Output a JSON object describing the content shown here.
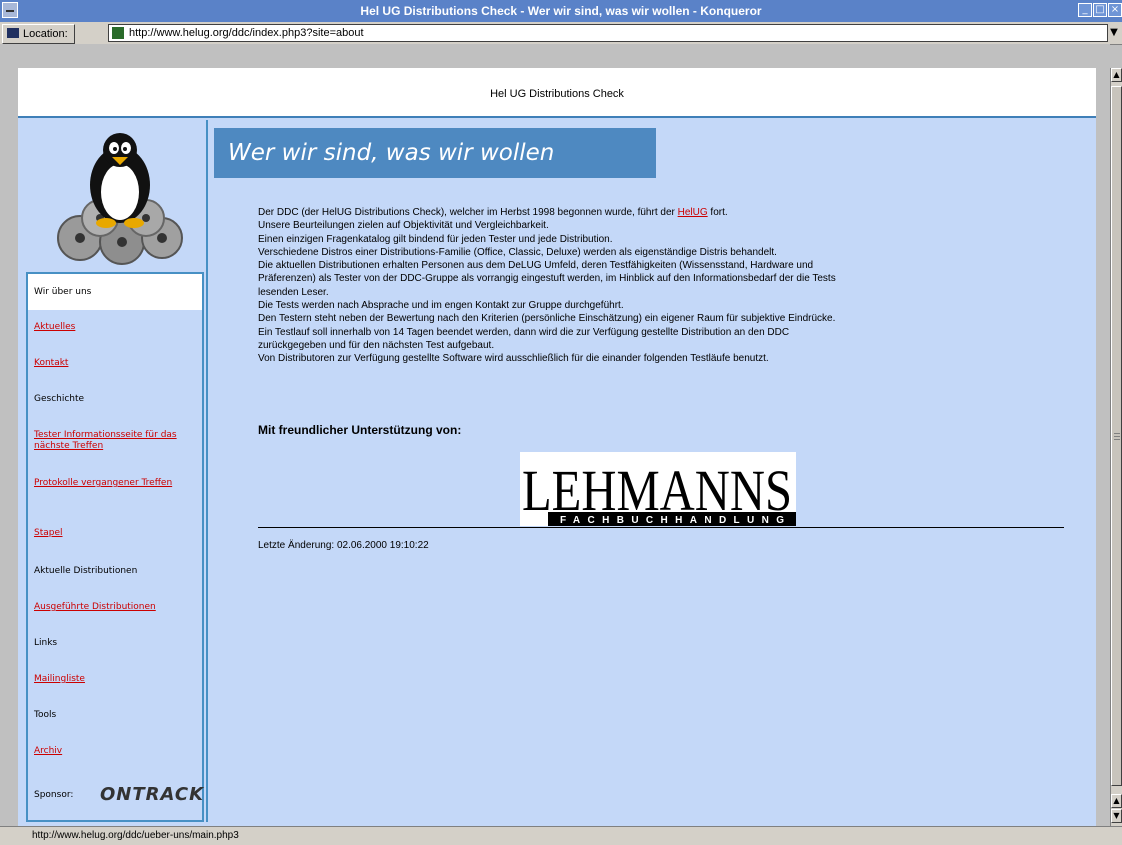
{
  "window": {
    "title": "Hel UG Distributions Check - Wer wir sind, was wir wollen - Konqueror"
  },
  "toolbar": {
    "location_label": "Location:",
    "url": "http://www.helug.org/ddc/index.php3?site=about"
  },
  "page": {
    "header_title": "Hel UG Distributions Check",
    "heading": "Wer wir sind, was wir wollen",
    "body_lines": [
      "Der DDC (der HelUG Distributions Check), welcher im Herbst 1998 begonnen wurde, führt der ",
      "Unsere Beurteilungen zielen auf Objektivität und Vergleichbarkeit.",
      "Einen einzigen Fragenkatalog gilt bindend für jeden Tester und jede Distribution.",
      "Verschiedene Distros einer Distributions-Familie (Office, Classic, Deluxe) werden als eigenständige Distris behandelt.",
      "Die aktuellen Distributionen erhalten Personen aus dem DeLUG Umfeld, deren Testfähigkeiten (Wissensstand, Hardware und",
      "Präferenzen) als Tester von der DDC-Gruppe als vorrangig eingestuft werden, im Hinblick auf den Informationsbedarf der die Tests",
      "lesenden Leser.",
      "Die Tests werden nach Absprache und im engen Kontakt zur Gruppe durchgeführt.",
      "Den Testern steht neben der Bewertung nach den Kriterien (persönliche Einschätzung) ein eigener Raum für subjektive Eindrücke.",
      "Ein Testlauf soll innerhalb von 14 Tagen beendet werden, dann wird die zur Verfügung gestellte Distribution an den DDC",
      "zurückgegeben und für den nächsten Test aufgebaut.",
      "Von Distributoren zur Verfügung gestellte Software wird ausschließlich für die einander folgenden Testläufe benutzt."
    ],
    "helug_link": "HelUG",
    "line0_suffix": " fort.",
    "support_text": "Mit freundlicher Unterstützung von:",
    "sponsor_big": "LEHMANNS",
    "sponsor_small": "FACHBUCHHANDLUNG",
    "last_change": "Letzte Änderung: 02.06.2000 19:10:22"
  },
  "sidebar": {
    "active_item": "Wir über uns",
    "items": [
      {
        "label": "Aktuelles",
        "link": true
      },
      {
        "label": "Kontakt",
        "link": true
      },
      {
        "label": "Geschichte",
        "link": false
      },
      {
        "label": "Tester Informationsseite für das nächste Treffen",
        "link": true
      },
      {
        "label": "Protokolle vergangener Treffen",
        "link": true
      },
      {
        "label": "Stapel",
        "link": true
      },
      {
        "label": "Aktuelle Distributionen",
        "link": false
      },
      {
        "label": "Ausgeführte Distributionen",
        "link": true
      },
      {
        "label": "Links",
        "link": false
      },
      {
        "label": "Mailingliste",
        "link": true
      },
      {
        "label": "Tools",
        "link": false
      },
      {
        "label": "Archiv",
        "link": true
      }
    ],
    "sponsor_label": "Sponsor:",
    "sponsor_logo": "ONTRACK"
  },
  "status": {
    "text": "http://www.helug.org/ddc/ueber-uns/main.php3"
  },
  "colors": {
    "accent": "#4e89c1",
    "background": "#c4d8f8",
    "link": "#cc0000"
  }
}
